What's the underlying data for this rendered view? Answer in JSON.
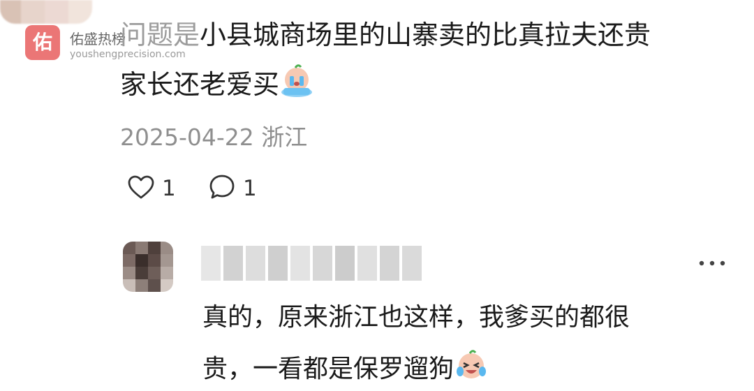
{
  "watermark": {
    "logo_char": "佑",
    "name": "佑盛热榜",
    "url": "youshengprecision.com"
  },
  "comment": {
    "line1_faded": "问题是",
    "line1": "小县城商场里的山寨卖的比真拉夫还贵",
    "line2": "家长还老爱买",
    "emoji": "crying-emoji",
    "date": "2025-04-22",
    "location": "浙江",
    "like_count": "1",
    "reply_count": "1"
  },
  "reply": {
    "line1": "真的，原来浙江也这样，我爹买的都很",
    "line2": "贵，一看都是保罗遛狗",
    "emoji": "crying-laugh-emoji",
    "more_icon": "more-icon"
  },
  "colors": {
    "text": "#1a1a1a",
    "meta": "#8f8f8f",
    "watermark_logo": "#e85f5f"
  }
}
